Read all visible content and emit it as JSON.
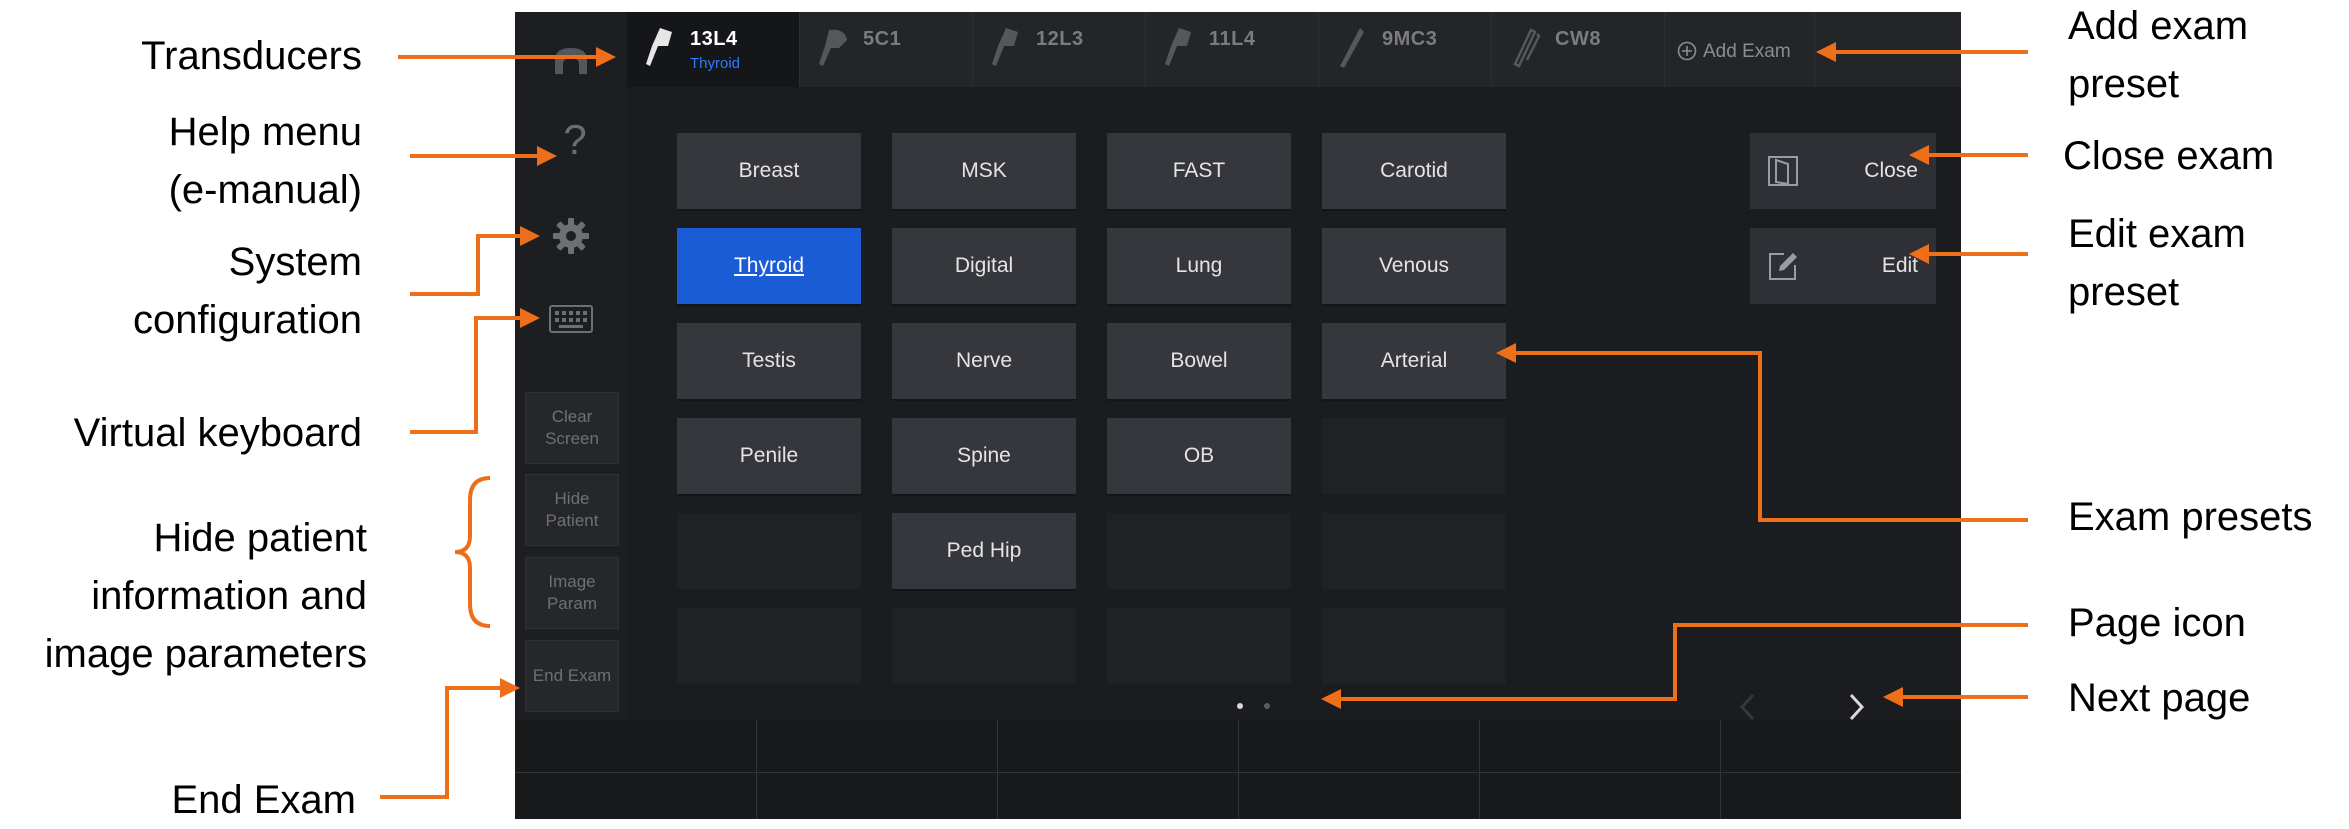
{
  "annotations": {
    "transducers": "Transducers",
    "help_menu": [
      "Help menu",
      "(e-manual)"
    ],
    "system_configuration": [
      "System",
      "configuration"
    ],
    "virtual_keyboard": "Virtual keyboard",
    "hide_patient": [
      "Hide patient",
      "information and",
      "image parameters"
    ],
    "end_exam": "End Exam",
    "add_exam_preset": [
      "Add exam",
      "preset"
    ],
    "close_exam": "Close exam",
    "edit_exam_preset": [
      "Edit exam",
      "preset"
    ],
    "exam_presets": "Exam presets",
    "page_icon": "Page icon",
    "next_page": "Next page"
  },
  "colors": {
    "annotation_arrow": "#ee6f1a",
    "selected_preset": "#1a5bd6",
    "selected_sub": "#2e7bff"
  },
  "transducer_tabs": [
    {
      "name": "13L4",
      "sub": "Thyroid",
      "active": true,
      "icon": "linear-probe-icon"
    },
    {
      "name": "5C1",
      "sub": "",
      "active": false,
      "icon": "convex-probe-icon"
    },
    {
      "name": "12L3",
      "sub": "",
      "active": false,
      "icon": "linear-probe-icon"
    },
    {
      "name": "11L4",
      "sub": "",
      "active": false,
      "icon": "linear-probe-icon"
    },
    {
      "name": "9MC3",
      "sub": "",
      "active": false,
      "icon": "micro-convex-probe-icon"
    },
    {
      "name": "CW8",
      "sub": "",
      "active": false,
      "icon": "pencil-probe-icon"
    }
  ],
  "add_exam_label": "Add Exam",
  "sidebar": {
    "help": "?",
    "clear_screen": "Clear Screen",
    "hide_patient": "Hide Patient",
    "image_param": "Image Param",
    "end_exam": "End Exam"
  },
  "presets": {
    "columns": [
      [
        "Breast",
        "Thyroid",
        "Testis",
        "Penile",
        "",
        ""
      ],
      [
        "MSK",
        "Digital",
        "Nerve",
        "Spine",
        "Ped Hip",
        ""
      ],
      [
        "FAST",
        "Lung",
        "Bowel",
        "OB",
        "",
        ""
      ],
      [
        "Carotid",
        "Venous",
        "Arterial",
        "",
        "",
        ""
      ]
    ],
    "selected": "Thyroid"
  },
  "actions": {
    "close": "Close",
    "edit": "Edit"
  },
  "pagination": {
    "current_page": 1,
    "total_pages": 2
  }
}
